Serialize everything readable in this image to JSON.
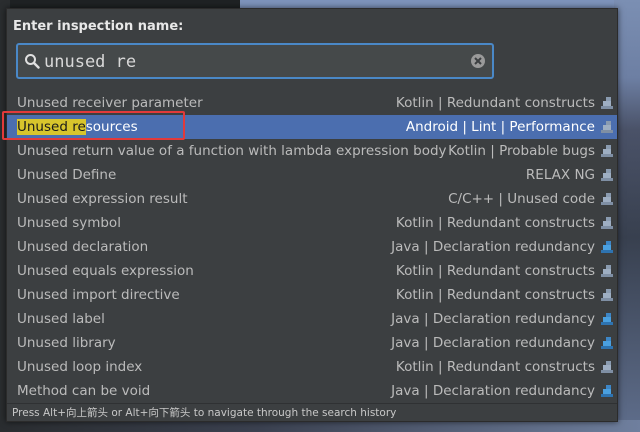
{
  "dialog": {
    "title": "Enter inspection name:",
    "search_value": "unused re",
    "search_highlight": "Unused re",
    "footer_hint": "Press Alt+向上箭头 or Alt+向下箭头 to navigate through the search history"
  },
  "results": [
    {
      "name": "Unused receiver parameter",
      "category": "Kotlin | Redundant constructs",
      "profile_icon": "profile-icon",
      "selected": false
    },
    {
      "name": "Unused resources",
      "name_highlight": "Unused re",
      "name_rest": "sources",
      "category": "Android | Lint | Performance",
      "profile_icon": "profile-icon",
      "selected": true
    },
    {
      "name": "Unused return value of a function with lambda expression body",
      "category": "Kotlin | Probable bugs",
      "profile_icon": "profile-icon",
      "selected": false
    },
    {
      "name": "Unused Define",
      "category": "RELAX NG",
      "profile_icon": "profile-icon",
      "selected": false
    },
    {
      "name": "Unused expression result",
      "category": "C/C++ | Unused code",
      "profile_icon": "profile-icon",
      "selected": false
    },
    {
      "name": "Unused symbol",
      "category": "Kotlin | Redundant constructs",
      "profile_icon": "profile-icon",
      "selected": false
    },
    {
      "name": "Unused declaration",
      "category": "Java | Declaration redundancy",
      "profile_icon": "profile-icon-blue",
      "selected": false
    },
    {
      "name": "Unused equals expression",
      "category": "Kotlin | Redundant constructs",
      "profile_icon": "profile-icon",
      "selected": false
    },
    {
      "name": "Unused import directive",
      "category": "Kotlin | Redundant constructs",
      "profile_icon": "profile-icon",
      "selected": false
    },
    {
      "name": "Unused label",
      "category": "Java | Declaration redundancy",
      "profile_icon": "profile-icon-blue",
      "selected": false
    },
    {
      "name": "Unused library",
      "category": "Java | Declaration redundancy",
      "profile_icon": "profile-icon-blue",
      "selected": false
    },
    {
      "name": "Unused loop index",
      "category": "Kotlin | Redundant constructs",
      "profile_icon": "profile-icon",
      "selected": false
    },
    {
      "name": "Method can be void",
      "category": "Java | Declaration redundancy",
      "profile_icon": "profile-icon-blue",
      "selected": false
    }
  ],
  "colors": {
    "popup_bg": "#3c3f41",
    "selection": "#4b6eaf",
    "search_border": "#4a88c7",
    "match_highlight": "#d8c52c",
    "annotation": "#e23a3a"
  }
}
